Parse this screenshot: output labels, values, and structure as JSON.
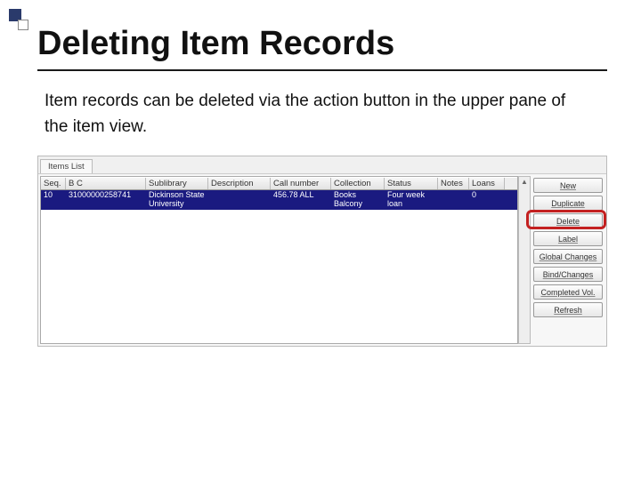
{
  "slide": {
    "title": "Deleting Item Records",
    "blurb": "Item records can be deleted via the action button in the upper pane of the item view."
  },
  "app": {
    "tab": "Items List",
    "columns": {
      "seq": "Seq.",
      "bc": "B C",
      "sub": "Sublibrary",
      "des": "Description",
      "call": "Call number",
      "coll": "Collection",
      "stat": "Status",
      "note": "Notes",
      "loan": "Loans"
    },
    "row": {
      "seq": "10",
      "bc": "31000000258741",
      "sub": "Dickinson State University",
      "des": "",
      "call": "456.78 ALL",
      "coll": "Books Balcony",
      "stat": "Four week loan",
      "note": "",
      "loan": "0"
    },
    "buttons": {
      "new": "New",
      "duplicate": "Duplicate",
      "delete": "Delete",
      "label": "Label",
      "global": "Global Changes",
      "bind": "Bind/Changes",
      "completed": "Completed Vol.",
      "refresh": "Refresh"
    }
  }
}
